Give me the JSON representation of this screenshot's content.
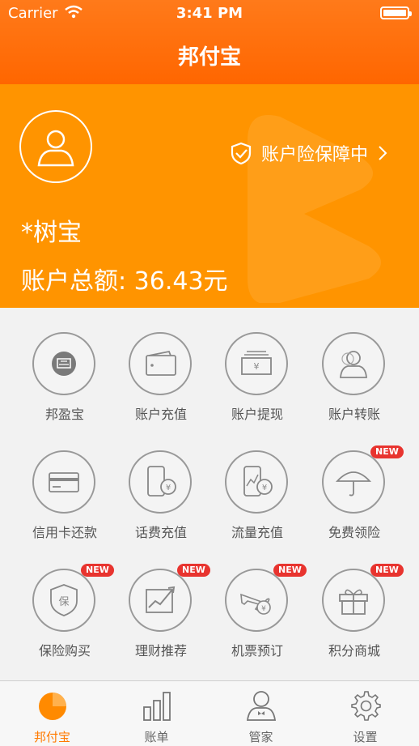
{
  "status_bar": {
    "carrier": "Carrier",
    "time": "3:41 PM"
  },
  "nav": {
    "title": "邦付宝"
  },
  "account": {
    "protection_text": "账户险保障中",
    "username": "*树宝",
    "balance_text": "账户总额: 36.43元"
  },
  "services": [
    {
      "label": "邦盈宝",
      "icon": "piggy-bank-icon",
      "badge": ""
    },
    {
      "label": "账户充值",
      "icon": "wallet-icon",
      "badge": ""
    },
    {
      "label": "账户提现",
      "icon": "cash-withdraw-icon",
      "badge": ""
    },
    {
      "label": "账户转账",
      "icon": "transfer-user-icon",
      "badge": ""
    },
    {
      "label": "信用卡还款",
      "icon": "credit-card-icon",
      "badge": ""
    },
    {
      "label": "话费充值",
      "icon": "phone-topup-icon",
      "badge": ""
    },
    {
      "label": "流量充值",
      "icon": "data-topup-icon",
      "badge": ""
    },
    {
      "label": "免费领险",
      "icon": "umbrella-icon",
      "badge": "NEW"
    },
    {
      "label": "保险购买",
      "icon": "insurance-shield-icon",
      "badge": "NEW"
    },
    {
      "label": "理财推荐",
      "icon": "trend-chart-icon",
      "badge": "NEW"
    },
    {
      "label": "机票预订",
      "icon": "airplane-icon",
      "badge": "NEW"
    },
    {
      "label": "积分商城",
      "icon": "gift-icon",
      "badge": "NEW"
    }
  ],
  "tabs": [
    {
      "label": "邦付宝",
      "icon": "home-pie-icon"
    },
    {
      "label": "账单",
      "icon": "bar-chart-icon"
    },
    {
      "label": "管家",
      "icon": "butler-icon"
    },
    {
      "label": "设置",
      "icon": "gear-icon"
    }
  ],
  "colors": {
    "primary": "#ff7a00",
    "banner": "#ff9400",
    "badge": "#e8342f"
  }
}
